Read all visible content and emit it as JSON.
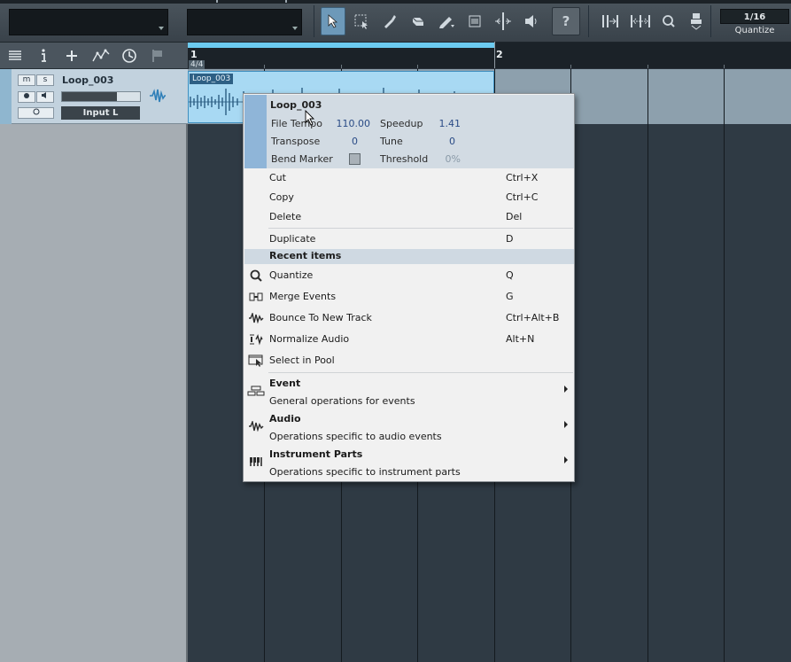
{
  "toolbar": {
    "quantize_value": "1/16",
    "quantize_label": "Quantize",
    "help_label": "?"
  },
  "track": {
    "name": "Loop_003",
    "mute_label": "m",
    "solo_label": "s",
    "input_label": "Input L"
  },
  "ruler": {
    "bar_1": "1",
    "bar_2": "2",
    "time_signature": "4/4"
  },
  "event": {
    "title": "Loop_003"
  },
  "context_menu": {
    "inspector": {
      "title": "Loop_003",
      "file_tempo_label": "File Tempo",
      "file_tempo_value": "110.00",
      "speedup_label": "Speedup",
      "speedup_value": "1.41",
      "transpose_label": "Transpose",
      "transpose_value": "0",
      "tune_label": "Tune",
      "tune_value": "0",
      "bend_marker_label": "Bend Marker",
      "threshold_label": "Threshold",
      "threshold_value": "0%"
    },
    "items": [
      {
        "label": "Cut",
        "shortcut": "Ctrl+X"
      },
      {
        "label": "Copy",
        "shortcut": "Ctrl+C"
      },
      {
        "label": "Delete",
        "shortcut": "Del"
      },
      {
        "label": "Duplicate",
        "shortcut": "D"
      }
    ],
    "recent_header": "Recent items",
    "recent": [
      {
        "label": "Quantize",
        "shortcut": "Q",
        "icon": "quantize-icon"
      },
      {
        "label": "Merge Events",
        "shortcut": "G",
        "icon": "merge-events-icon"
      },
      {
        "label": "Bounce To New Track",
        "shortcut": "Ctrl+Alt+B",
        "icon": "bounce-icon"
      },
      {
        "label": "Normalize Audio",
        "shortcut": "Alt+N",
        "icon": "normalize-icon"
      },
      {
        "label": "Select in Pool",
        "shortcut": "",
        "icon": "select-in-pool-icon"
      }
    ],
    "submenus": [
      {
        "title": "Event",
        "description": "General operations for events",
        "icon": "event-icon"
      },
      {
        "title": "Audio",
        "description": "Operations specific to audio events",
        "icon": "audio-wave-icon"
      },
      {
        "title": "Instrument Parts",
        "description": "Operations specific to instrument parts",
        "icon": "instrument-parts-icon"
      }
    ]
  }
}
